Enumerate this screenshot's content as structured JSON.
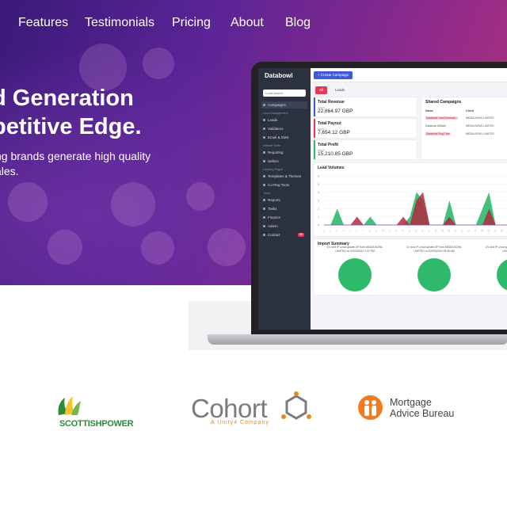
{
  "nav": {
    "items": [
      "Features",
      "Testimonials",
      "Pricing",
      "About",
      "Blog"
    ]
  },
  "hero": {
    "headline_line1": "d Generation",
    "headline_line2": "petitive Edge.",
    "subtext_line1": "ng brands generate high quality",
    "subtext_line2": "ales."
  },
  "app": {
    "brand": "Databowl",
    "search_placeholder": "Lead search",
    "create_button": "+ Create Campaign",
    "tabs": [
      "All",
      "Leads"
    ],
    "sidebar": [
      {
        "label": "Campaigns",
        "type": "item",
        "active": true
      },
      {
        "label": "Lead Management",
        "type": "head"
      },
      {
        "label": "Leads",
        "type": "item"
      },
      {
        "label": "Validators",
        "type": "item"
      },
      {
        "label": "Email & SMS",
        "type": "item"
      },
      {
        "label": "Affiliate Suite",
        "type": "head"
      },
      {
        "label": "Reporting",
        "type": "item"
      },
      {
        "label": "Sellers",
        "type": "item"
      },
      {
        "label": "Landing Pages",
        "type": "head"
      },
      {
        "label": "Templates & Themes",
        "type": "item"
      },
      {
        "label": "Co-Reg Tools",
        "type": "item"
      },
      {
        "label": "Tools",
        "type": "head"
      },
      {
        "label": "Reports",
        "type": "item"
      },
      {
        "label": "Tasks",
        "type": "item"
      },
      {
        "label": "Finance",
        "type": "item"
      },
      {
        "label": "Admin",
        "type": "item"
      },
      {
        "label": "Contact",
        "type": "item",
        "badge": "99"
      }
    ],
    "stats": [
      {
        "title": "Total Revenue",
        "sub": "Month",
        "value": "22,864.97 GBP",
        "color": "#3f5bd8"
      },
      {
        "title": "Total Payout",
        "sub": "Month",
        "value": "7,654.12 GBP",
        "color": "#e03b52"
      },
      {
        "title": "Total Profit",
        "sub": "Month",
        "value": "15,210.85 GBP",
        "color": "#2fba6b"
      }
    ],
    "shared": {
      "title": "Shared Campaigns",
      "headers": [
        "Name",
        "Client"
      ],
      "rows": [
        {
          "name": "Databowl Lead Generati...",
          "client": "MEDIA BOWL LIMITED"
        },
        {
          "name": "Databowl Affiliate",
          "client": "MEDIA BOWL LIMITED"
        },
        {
          "name": "Databowl Ping Tree",
          "client": "MEDIA BOWL LIMITED"
        }
      ]
    },
    "volumes_title": "Lead Volumes",
    "import_title": "Import Summary",
    "imports": [
      {
        "caption": "CV and IP Lead update AP from MEDIA BOWL LIMITED on 02/03/2022 2:37 PM"
      },
      {
        "caption": "CV and IP Lead update AP from MEDIA BOWL LIMITED on 02/03/2022 08:36 AM"
      },
      {
        "caption": "CV and IP Lead update AP from MEDIA BOWL LIMITED on 02/03"
      }
    ]
  },
  "chart_data": {
    "type": "area",
    "title": "Lead Volumes",
    "ylim": [
      0,
      6
    ],
    "y_ticks": [
      0,
      1,
      2,
      3,
      4,
      5,
      6
    ],
    "x": [
      "1",
      "2",
      "3",
      "4",
      "5",
      "6",
      "7",
      "8",
      "9",
      "10",
      "11",
      "12",
      "13",
      "14",
      "15",
      "16",
      "17",
      "18",
      "19",
      "20",
      "21",
      "22",
      "23",
      "24",
      "25",
      "26",
      "27",
      "28",
      "29",
      "30",
      "31"
    ],
    "series": [
      {
        "color": "#2fba6b",
        "values": [
          0,
          0,
          2,
          0,
          0,
          0,
          0,
          1,
          0,
          0,
          0,
          0,
          0,
          1,
          4,
          3,
          0,
          0,
          0,
          3,
          0,
          0,
          0,
          0,
          2,
          4,
          0,
          0,
          0,
          0,
          0
        ]
      },
      {
        "color": "#b02a3e",
        "values": [
          0,
          0,
          0,
          0,
          0,
          1,
          0,
          0,
          0,
          0,
          0,
          0,
          1,
          0,
          3,
          4,
          0,
          0,
          0,
          1,
          0,
          0,
          0,
          0,
          0,
          2,
          0,
          0,
          0,
          0,
          0
        ]
      }
    ]
  },
  "logos": {
    "scottishpower": "SCOTTISHPOWER",
    "cohort": "Cohort",
    "cohort_sub": "A Unity4 Company",
    "mab_line1": "Mortgage",
    "mab_line2": "Advice Bureau"
  }
}
